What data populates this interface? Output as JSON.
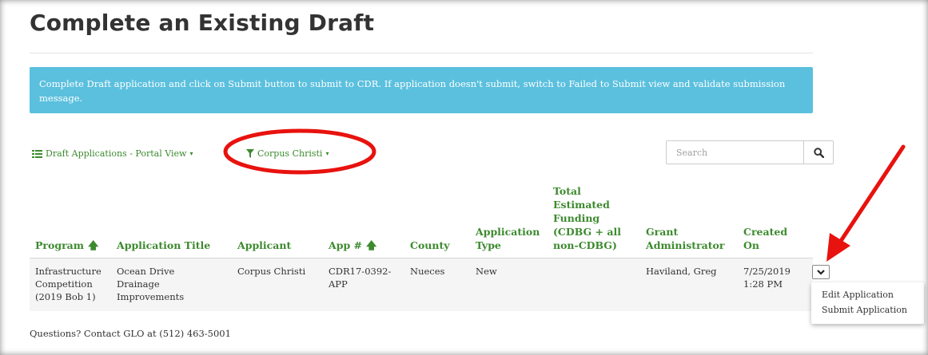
{
  "page": {
    "title": "Complete an Existing Draft",
    "info_banner": "Complete Draft application and click on Submit button to submit to CDR. If application doesn't submit, switch to Failed to Submit view and validate submission message."
  },
  "views": {
    "draft_view_label": "Draft Applications - Portal View",
    "filter_label": "Corpus Christi",
    "caret": "▾"
  },
  "search": {
    "placeholder": "Search",
    "icon": "search-icon"
  },
  "table": {
    "headers": {
      "program": "Program",
      "application_title": "Application Title",
      "applicant": "Applicant",
      "app_number_line1": "App #",
      "county": "County",
      "application_type_line1": "Application",
      "application_type_line2": "Type",
      "funding_line1": "Total",
      "funding_line2": "Estimated",
      "funding_line3": "Funding",
      "funding_line4": "(CDBG + all",
      "funding_line5": "non-CDBG)",
      "grant_admin_line1": "Grant",
      "grant_admin_line2": "Administrator",
      "created_line1": "Created",
      "created_line2": "On",
      "sort_arrow": "🡅"
    },
    "rows": [
      {
        "program_line1": "Infrastructure",
        "program_line2": "Competition",
        "program_line3": "(2019 Bob 1)",
        "title_line1": "Ocean Drive",
        "title_line2": "Drainage",
        "title_line3": "Improvements",
        "applicant": "Corpus Christi",
        "app_number_line1": "CDR17-0392-",
        "app_number_line2": "APP",
        "county": "Nueces",
        "application_type": "New",
        "funding": "",
        "grant_administrator": "Haviland, Greg",
        "created_line1": "7/25/2019",
        "created_line2": "1:28 PM"
      }
    ]
  },
  "row_menu": {
    "items": [
      "Edit Application",
      "Submit Application"
    ]
  },
  "footer": {
    "contact": "Questions? Contact GLO at (512) 463-5001"
  },
  "colors": {
    "accent_green": "#3c8a2e",
    "banner_blue": "#5bc0de",
    "annotation_red": "#e8120e"
  }
}
